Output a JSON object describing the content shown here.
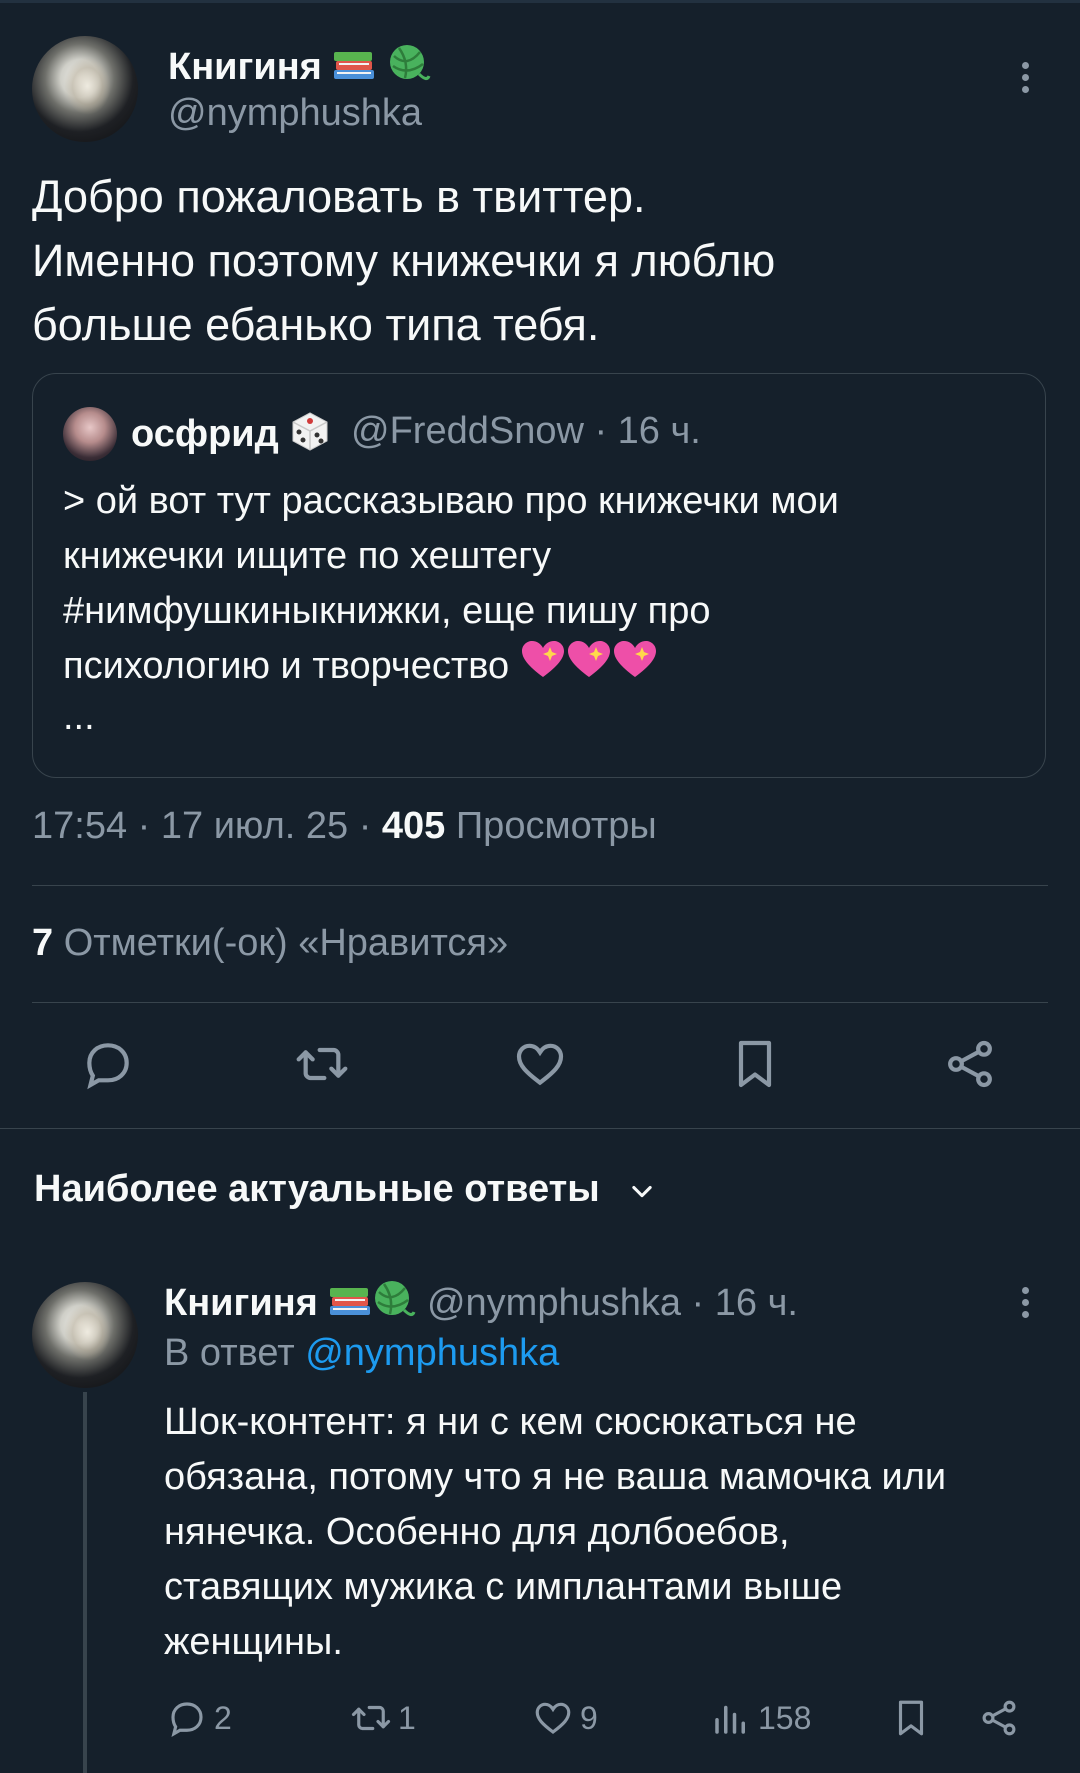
{
  "tweet": {
    "author_name": "Книгиня",
    "author_handle": "@nymphushka",
    "author_emojis": [
      "books-emoji",
      "yarn-emoji"
    ],
    "text_lines": [
      "Добро пожаловать в твиттер.",
      "Именно поэтому книжечки я люблю",
      "больше ебанько типа тебя."
    ],
    "quote": {
      "author_name": "осфрид",
      "author_emoji": "dice-emoji",
      "author_handle": "@FreddSnow · 16 ч.",
      "text_lines": [
        "> ой вот тут рассказываю про книжечки мои",
        "книжечки ищите по хештегу",
        "#нимфушкиныкнижки, еще пишу про",
        "психологию и творчество"
      ],
      "trailing_emojis": [
        "sparkling-heart",
        "sparkling-heart",
        "sparkling-heart"
      ],
      "ellipsis": "..."
    },
    "time_date": "17:54 · 17 июл. 25 · ",
    "views_count": "405",
    "views_label": " Просмотры",
    "likes_count": "7",
    "likes_label": " Отметки(-ок) «Нравится»",
    "actions": [
      "reply-icon",
      "retweet-icon",
      "like-icon",
      "bookmark-icon",
      "share-icon"
    ]
  },
  "replies_section": {
    "title": "Наиболее актуальные ответы"
  },
  "reply": {
    "author_name": "Книгиня",
    "author_handle": "@nymphushka · 16 ч.",
    "reply_to_label": "В ответ ",
    "reply_to_handle": "@nymphushka",
    "text_lines": [
      "Шок-контент: я ни с кем сюсюкаться не",
      "обязана, потому что я не ваша мамочка или",
      "нянечка. Особенно для долбоебов,",
      "ставящих мужика с имплантами выше",
      "женщины."
    ],
    "replies_count": "2",
    "retweets_count": "1",
    "likes_count": "9",
    "views_count": "158"
  },
  "colors": {
    "background": "#15202b",
    "text_primary": "#f7f9f9",
    "text_secondary": "#8b98a5",
    "border": "#38444d",
    "link": "#1d9bf0"
  }
}
